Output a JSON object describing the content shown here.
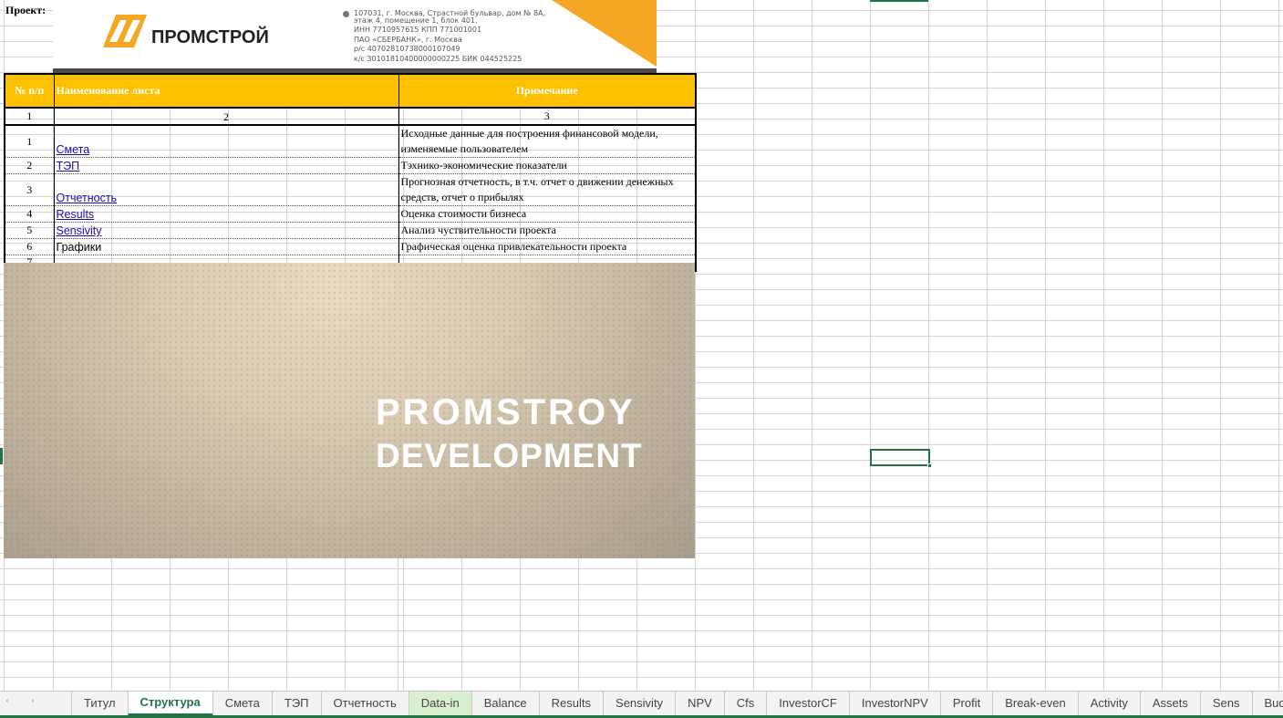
{
  "sheet": {
    "project_label": "Проект:",
    "letterhead": {
      "company_name": "ПРОМСТРОЙ",
      "address_lines": [
        "107031, г. Москва, Страстной бульвар, дом № 8А,",
        "этаж 4, помещение 1, блок 401.",
        "ИНН 7710957615     КПП 771001001",
        "ПАО «СБЕРБАНК», г. Москва",
        "р/с 40702810738000107049",
        "к/с 30101810400000000225               БИК 044525225"
      ],
      "brand_color": "#f5a623",
      "pin_icon": "location-pin-icon"
    },
    "table": {
      "headers": {
        "num": "№ п/п",
        "name": "Наименование листа",
        "note": "Примечание"
      },
      "column_numbers": [
        "1",
        "2",
        "3"
      ],
      "rows": [
        {
          "num": "1",
          "name": "Смета",
          "note": "Исходные данные для построения финансовой модели, изменяемые пользователем",
          "link": true
        },
        {
          "num": "2",
          "name": "ТЭП",
          "note": "Тэхнико-экономические показатели",
          "link": true
        },
        {
          "num": "3",
          "name": "Отчетность",
          "note": "Прогнозная отчетность, в т.ч. отчет о движении денежных средств, отчет о прибылях",
          "link": true
        },
        {
          "num": "4",
          "name": "Results",
          "note": "Оценка стоимости бизнеса",
          "link": true
        },
        {
          "num": "5",
          "name": "Sensivity",
          "note": "Анализ чуствительности проекта",
          "link": true
        },
        {
          "num": "6",
          "name": "Графики",
          "note": "Графическая оценка привлекательности проекта",
          "link": false
        },
        {
          "num": "7",
          "name": "",
          "note": "",
          "link": false
        }
      ],
      "header_color": "#ffc000"
    },
    "banner": {
      "line1": "PROMSTROY",
      "line2": "DEVELOPMENT"
    }
  },
  "tabbar": {
    "prev_icon": "‹",
    "next_icon": "›",
    "tabs": [
      {
        "label": "Титул",
        "state": "normal"
      },
      {
        "label": "Структура",
        "state": "active"
      },
      {
        "label": "Смета",
        "state": "normal"
      },
      {
        "label": "ТЭП",
        "state": "normal"
      },
      {
        "label": "Отчетность",
        "state": "normal"
      },
      {
        "label": "Data-in",
        "state": "green"
      },
      {
        "label": "Balance",
        "state": "normal"
      },
      {
        "label": "Results",
        "state": "normal"
      },
      {
        "label": "Sensivity",
        "state": "normal"
      },
      {
        "label": "NPV",
        "state": "normal"
      },
      {
        "label": "Cfs",
        "state": "normal"
      },
      {
        "label": "InvestorCF",
        "state": "normal"
      },
      {
        "label": "InvestorNPV",
        "state": "normal"
      },
      {
        "label": "Profit",
        "state": "normal"
      },
      {
        "label": "Break-even",
        "state": "normal"
      },
      {
        "label": "Activity",
        "state": "normal"
      },
      {
        "label": "Assets",
        "state": "normal"
      },
      {
        "label": "Sens",
        "state": "normal"
      },
      {
        "label": "Budjet",
        "state": "normal"
      }
    ],
    "accent_color": "#217346"
  }
}
